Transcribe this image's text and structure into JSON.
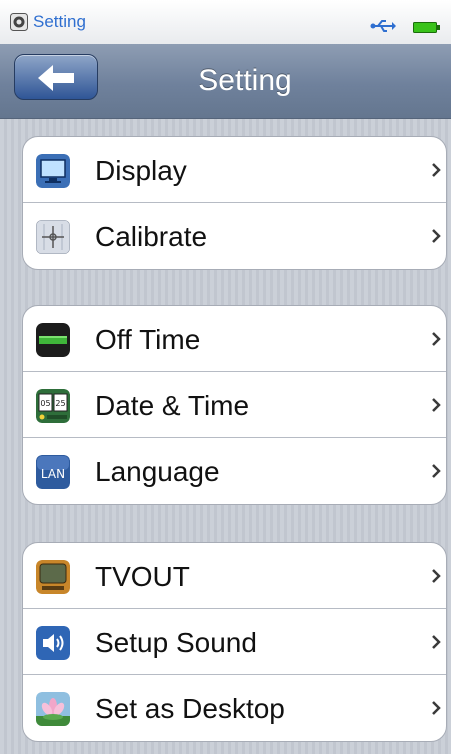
{
  "status_bar": {
    "app_title": "Setting"
  },
  "header": {
    "title": "Setting"
  },
  "groups": [
    {
      "items": [
        {
          "label": "Display"
        },
        {
          "label": "Calibrate"
        }
      ]
    },
    {
      "items": [
        {
          "label": "Off Time"
        },
        {
          "label": "Date & Time"
        },
        {
          "label": "Language"
        }
      ]
    },
    {
      "items": [
        {
          "label": "TVOUT"
        },
        {
          "label": "Setup Sound"
        },
        {
          "label": "Set as Desktop"
        }
      ]
    }
  ],
  "icons": {
    "status_app": "settings-app-icon",
    "usb": "usb-icon",
    "battery": "battery-icon",
    "back": "back-arrow-icon",
    "display": "display-monitor-icon",
    "calibrate": "calibrate-crosshair-icon",
    "off_time": "off-time-icon",
    "date_time": "date-time-icon",
    "language": "language-lan-icon",
    "tvout": "tv-icon",
    "setup_sound": "speaker-sound-icon",
    "set_as_desktop": "flower-wallpaper-icon"
  },
  "icon_text": {
    "date_time_left": "05",
    "date_time_right": "25",
    "language": "LAN"
  },
  "colors": {
    "status_title": "#2f6fd0",
    "header_background": "#6f819c",
    "back_button": "#3d64a8",
    "battery": "#39c21a",
    "usb": "#2f6fd0"
  }
}
